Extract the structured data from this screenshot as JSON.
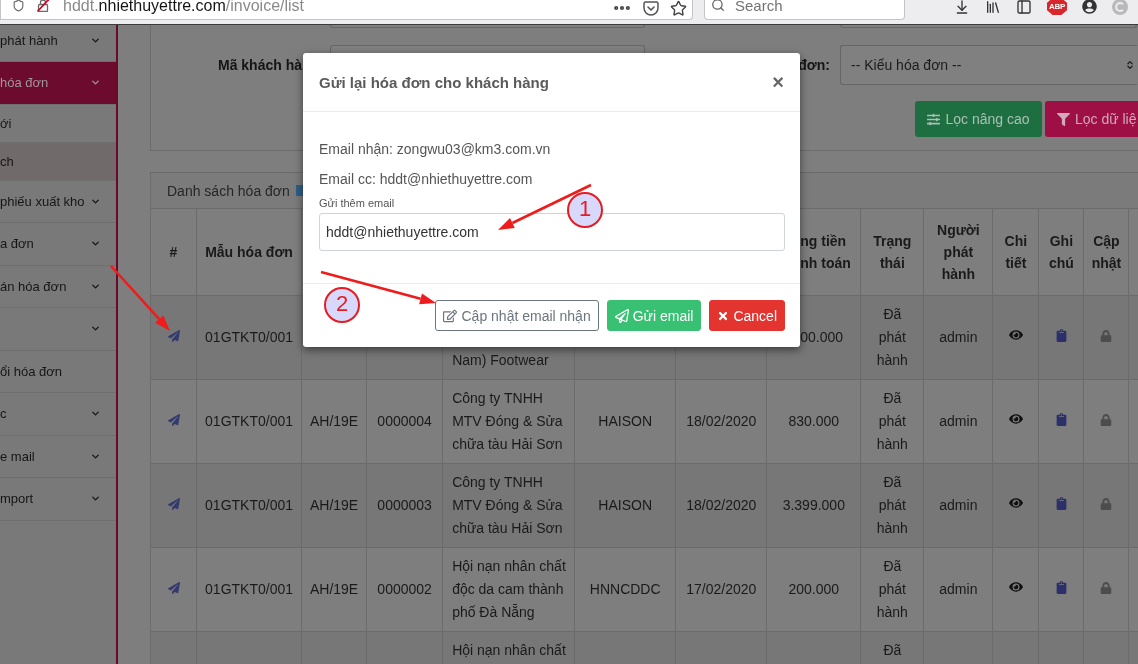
{
  "browser": {
    "url": "hddt.**nhiethuyettre.com**/invoice/list",
    "search": {
      "placeholder": "Search"
    },
    "extension_badge": "ABP"
  },
  "sidebar": {
    "items": [
      {
        "label": "phát hành",
        "expandable": true,
        "selected": false
      },
      {
        "label": "hóa đơn",
        "expandable": true,
        "selected": true,
        "children": [
          {
            "label": "ới",
            "selected": false
          },
          {
            "label": "ch",
            "selected": true
          }
        ]
      },
      {
        "label": "phiếu xuất kho",
        "expandable": true,
        "selected": false
      },
      {
        "label": "a đơn",
        "expandable": true,
        "selected": false
      },
      {
        "label": "án hóa đơn",
        "expandable": true,
        "selected": false
      },
      {
        "expandable": true,
        "selected": false
      },
      {
        "label": "ổi hóa đơn",
        "expandable": false,
        "selected": false
      },
      {
        "label": "c",
        "expandable": true,
        "selected": false
      },
      {
        "label": "e mail",
        "expandable": true,
        "selected": false
      },
      {
        "label": "mport",
        "expandable": true,
        "selected": false
      }
    ]
  },
  "filters": {
    "customer_code_label": "Mã khách hà",
    "invoice_type_label": "đơn:",
    "invoice_type": {
      "value": "-- Kiểu hóa đơn --"
    },
    "buttons": [
      {
        "label": "Lọc nâng cao",
        "kind": "advanced"
      },
      {
        "label": "Lọc dữ liệ",
        "kind": "filter"
      }
    ]
  },
  "invoice_list": {
    "title": "Danh sách hóa đơn"
  },
  "table": {
    "columns": [
      "#",
      "Mẫu hóa đơn",
      "ng tiền\nnh toán",
      "Trạng thái",
      "Người phát hành",
      "Chi tiết",
      "Ghi chú",
      "Cập nhật"
    ],
    "rows": [
      {
        "template": "01GTKT0/001",
        "column_5": "Nam) Footwear",
        "column_8": "00.000",
        "status": "Đã phát hành",
        "issuer": "admin"
      },
      {
        "template": "01GTKT0/001",
        "column_3": "AH/19E",
        "column_4": "0000004",
        "column_5": "Công ty TNHH MTV Đóng & Sửa chữa tàu Hải Sơn",
        "column_6": "HAISON",
        "column_7": "18/02/2020",
        "column_8": "830.000",
        "status": "Đã phát hành",
        "issuer": "admin"
      },
      {
        "template": "01GTKT0/001",
        "column_3": "AH/19E",
        "column_4": "0000003",
        "column_5": "Công ty TNHH MTV Đóng & Sửa chữa tàu Hải Sơn",
        "column_6": "HAISON",
        "column_7": "18/02/2020",
        "column_8": "3.399.000",
        "status": "Đã phát hành",
        "issuer": "admin"
      },
      {
        "template": "01GTKT0/001",
        "column_3": "AH/19E",
        "column_4": "0000002",
        "column_5": "Hội nạn nhân chất độc da cam thành phố Đà Nẵng",
        "column_6": "HNNCDDC",
        "column_7": "17/02/2020",
        "column_8": "200.000",
        "status": "Đã phát hành",
        "issuer": "admin"
      },
      {
        "column_5": "Hội nạn nhân chất",
        "status": "Đã"
      }
    ]
  },
  "dialog": {
    "title": "Gửi lại hóa đơn cho khách hàng",
    "close": "×",
    "lines": [
      "Email nhận: zongwu03@km3.com.vn",
      "Email cc: hddt@nhiethuyettre.com"
    ],
    "extra_email": {
      "label": "Gửi thêm email",
      "value": "hddt@nhiethuyettre.com"
    },
    "buttons": [
      {
        "label": "Cập nhật email nhận",
        "kind": "update"
      },
      {
        "label": "Gửi email",
        "kind": "send"
      },
      {
        "label": "Cancel",
        "kind": "cancel"
      }
    ]
  },
  "annotations": [
    {
      "label": "1"
    },
    {
      "label": "2"
    }
  ]
}
